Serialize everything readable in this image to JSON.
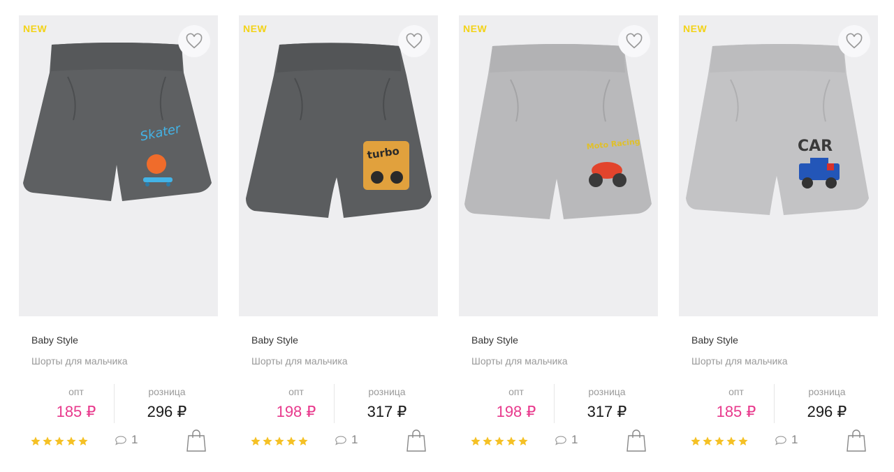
{
  "products": [
    {
      "badge": "NEW",
      "brand": "Baby Style",
      "title": "Шорты для мальчика",
      "opt_label": "опт",
      "opt_price": "185 ₽",
      "retail_label": "розница",
      "retail_price": "296 ₽",
      "rating": 5,
      "comments": "1",
      "image": {
        "color": "#5e6062",
        "print": "Skater"
      }
    },
    {
      "badge": "NEW",
      "brand": "Baby Style",
      "title": "Шорты для мальчика",
      "opt_label": "опт",
      "opt_price": "198 ₽",
      "retail_label": "розница",
      "retail_price": "317 ₽",
      "rating": 5,
      "comments": "1",
      "image": {
        "color": "#5b5d5f",
        "print": "turbo"
      }
    },
    {
      "badge": "NEW",
      "brand": "Baby Style",
      "title": "Шорты для мальчика",
      "opt_label": "опт",
      "opt_price": "198 ₽",
      "retail_label": "розница",
      "retail_price": "317 ₽",
      "rating": 5,
      "comments": "1",
      "image": {
        "color": "#b9b9bb",
        "print": "Moto Racing"
      }
    },
    {
      "badge": "NEW",
      "brand": "Baby Style",
      "title": "Шорты для мальчика",
      "opt_label": "опт",
      "opt_price": "185 ₽",
      "retail_label": "розница",
      "retail_price": "296 ₽",
      "rating": 5,
      "comments": "1",
      "image": {
        "color": "#c3c3c5",
        "print": "CAR"
      }
    }
  ],
  "colors": {
    "badge": "#f3d317",
    "opt_price": "#e8398c",
    "star": "#f5c125",
    "image_bg": "#eeeef0"
  },
  "icons": {
    "favorite": "heart-icon",
    "comment": "comment-bubble-icon",
    "cart": "shopping-bag-icon",
    "rating": "star-icon"
  }
}
